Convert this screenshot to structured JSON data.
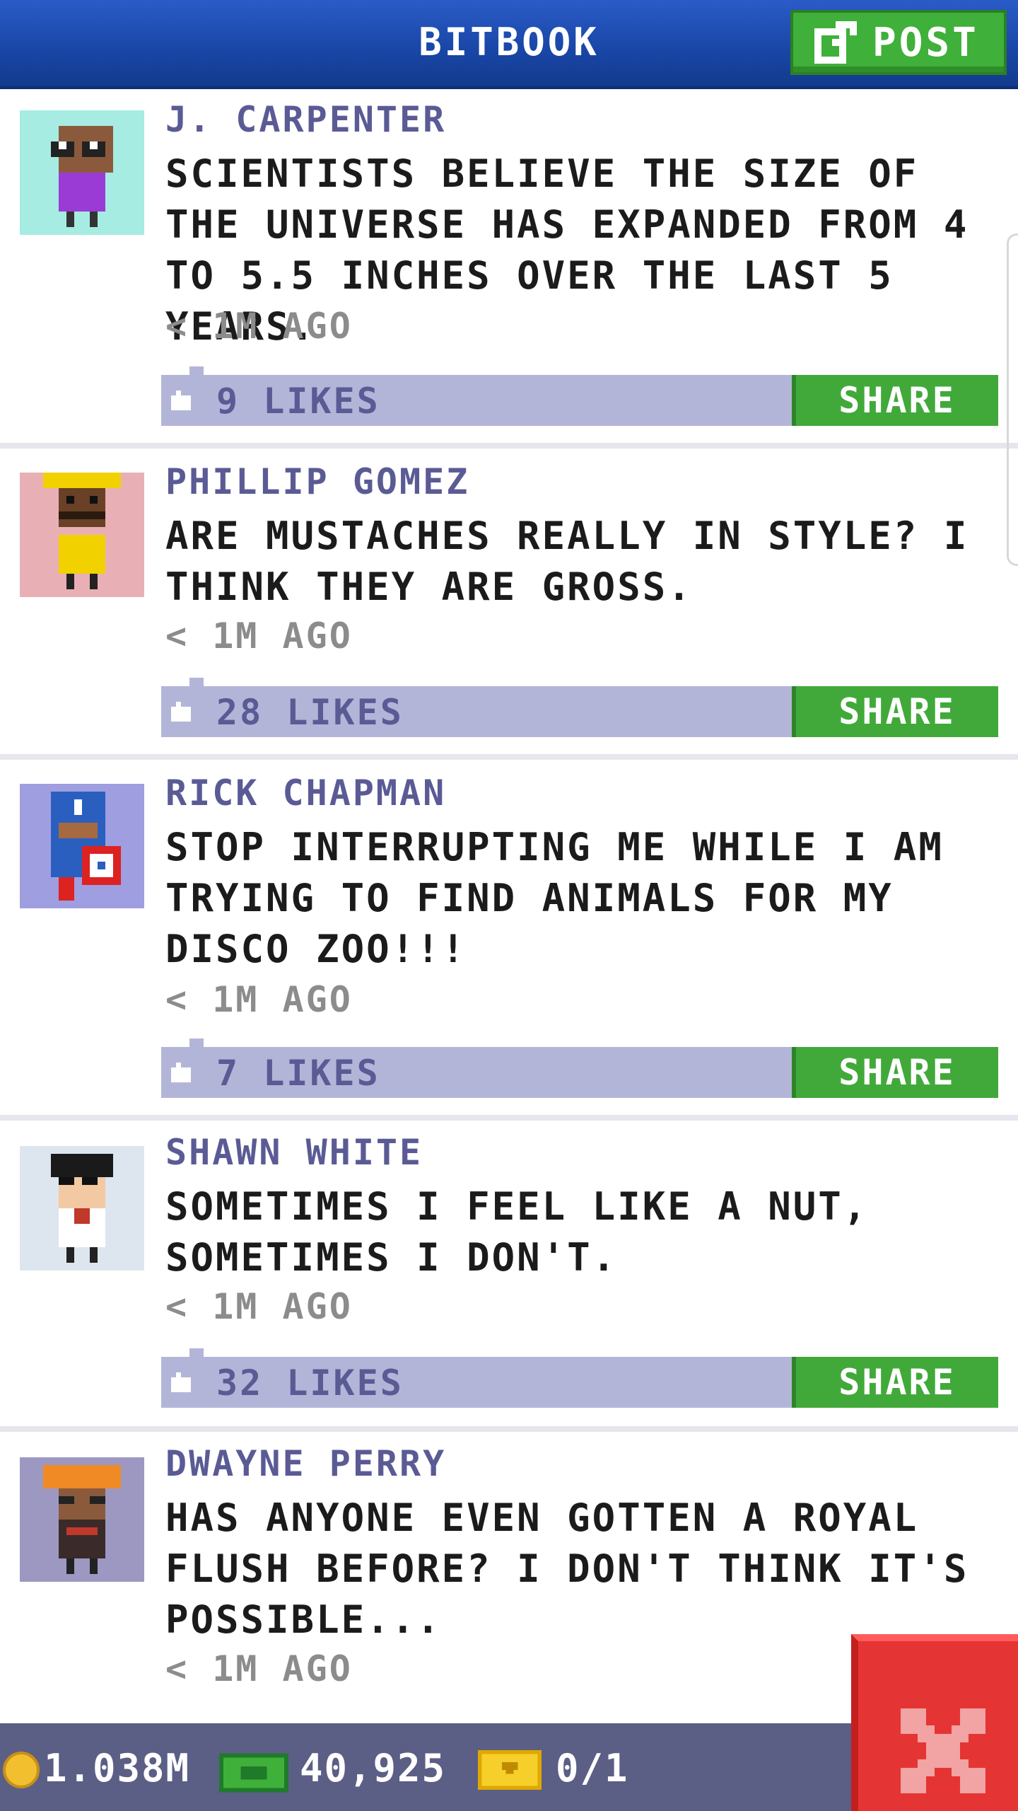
{
  "header": {
    "title": "BITBOOK",
    "post_label": "POST",
    "post_icon": "edit-icon",
    "colors": {
      "bar": "#1a47a8",
      "post_button": "#3fb03a"
    }
  },
  "posts": [
    {
      "author": "J. CARPENTER",
      "message": "SCIENTISTS BELIEVE THE SIZE OF THE UNIVERSE HAS EXPANDED FROM 4 TO 5.5 INCHES OVER THE LAST 5 YEARS.",
      "time": "< 1M AGO",
      "likes": "9 LIKES",
      "share": "SHARE",
      "avatar_bg": "#a6ece3"
    },
    {
      "author": "PHILLIP GOMEZ",
      "message": "ARE MUSTACHES REALLY IN STYLE? I THINK THEY ARE GROSS.",
      "time": "< 1M AGO",
      "likes": "28 LIKES",
      "share": "SHARE",
      "avatar_bg": "#e8b0b4"
    },
    {
      "author": "RICK CHAPMAN",
      "message": "STOP INTERRUPTING ME WHILE I AM TRYING TO FIND ANIMALS FOR MY DISCO ZOO!!!",
      "time": "< 1M AGO",
      "likes": "7 LIKES",
      "share": "SHARE",
      "avatar_bg": "#9f9ee0"
    },
    {
      "author": "SHAWN WHITE",
      "message": "SOMETIMES I FEEL LIKE A NUT, SOMETIMES I DON'T.",
      "time": "< 1M AGO",
      "likes": "32 LIKES",
      "share": "SHARE",
      "avatar_bg": "#dde6ee"
    },
    {
      "author": "DWAYNE PERRY",
      "message": "HAS ANYONE EVEN GOTTEN A ROYAL FLUSH BEFORE? I DON'T THINK IT'S POSSIBLE...",
      "time": "< 1M AGO",
      "avatar_bg": "#9d98c2"
    }
  ],
  "bottom_bar": {
    "coins": "1.038M",
    "bux": "40,925",
    "tickets": "0/1"
  },
  "close_icon": "close-icon"
}
